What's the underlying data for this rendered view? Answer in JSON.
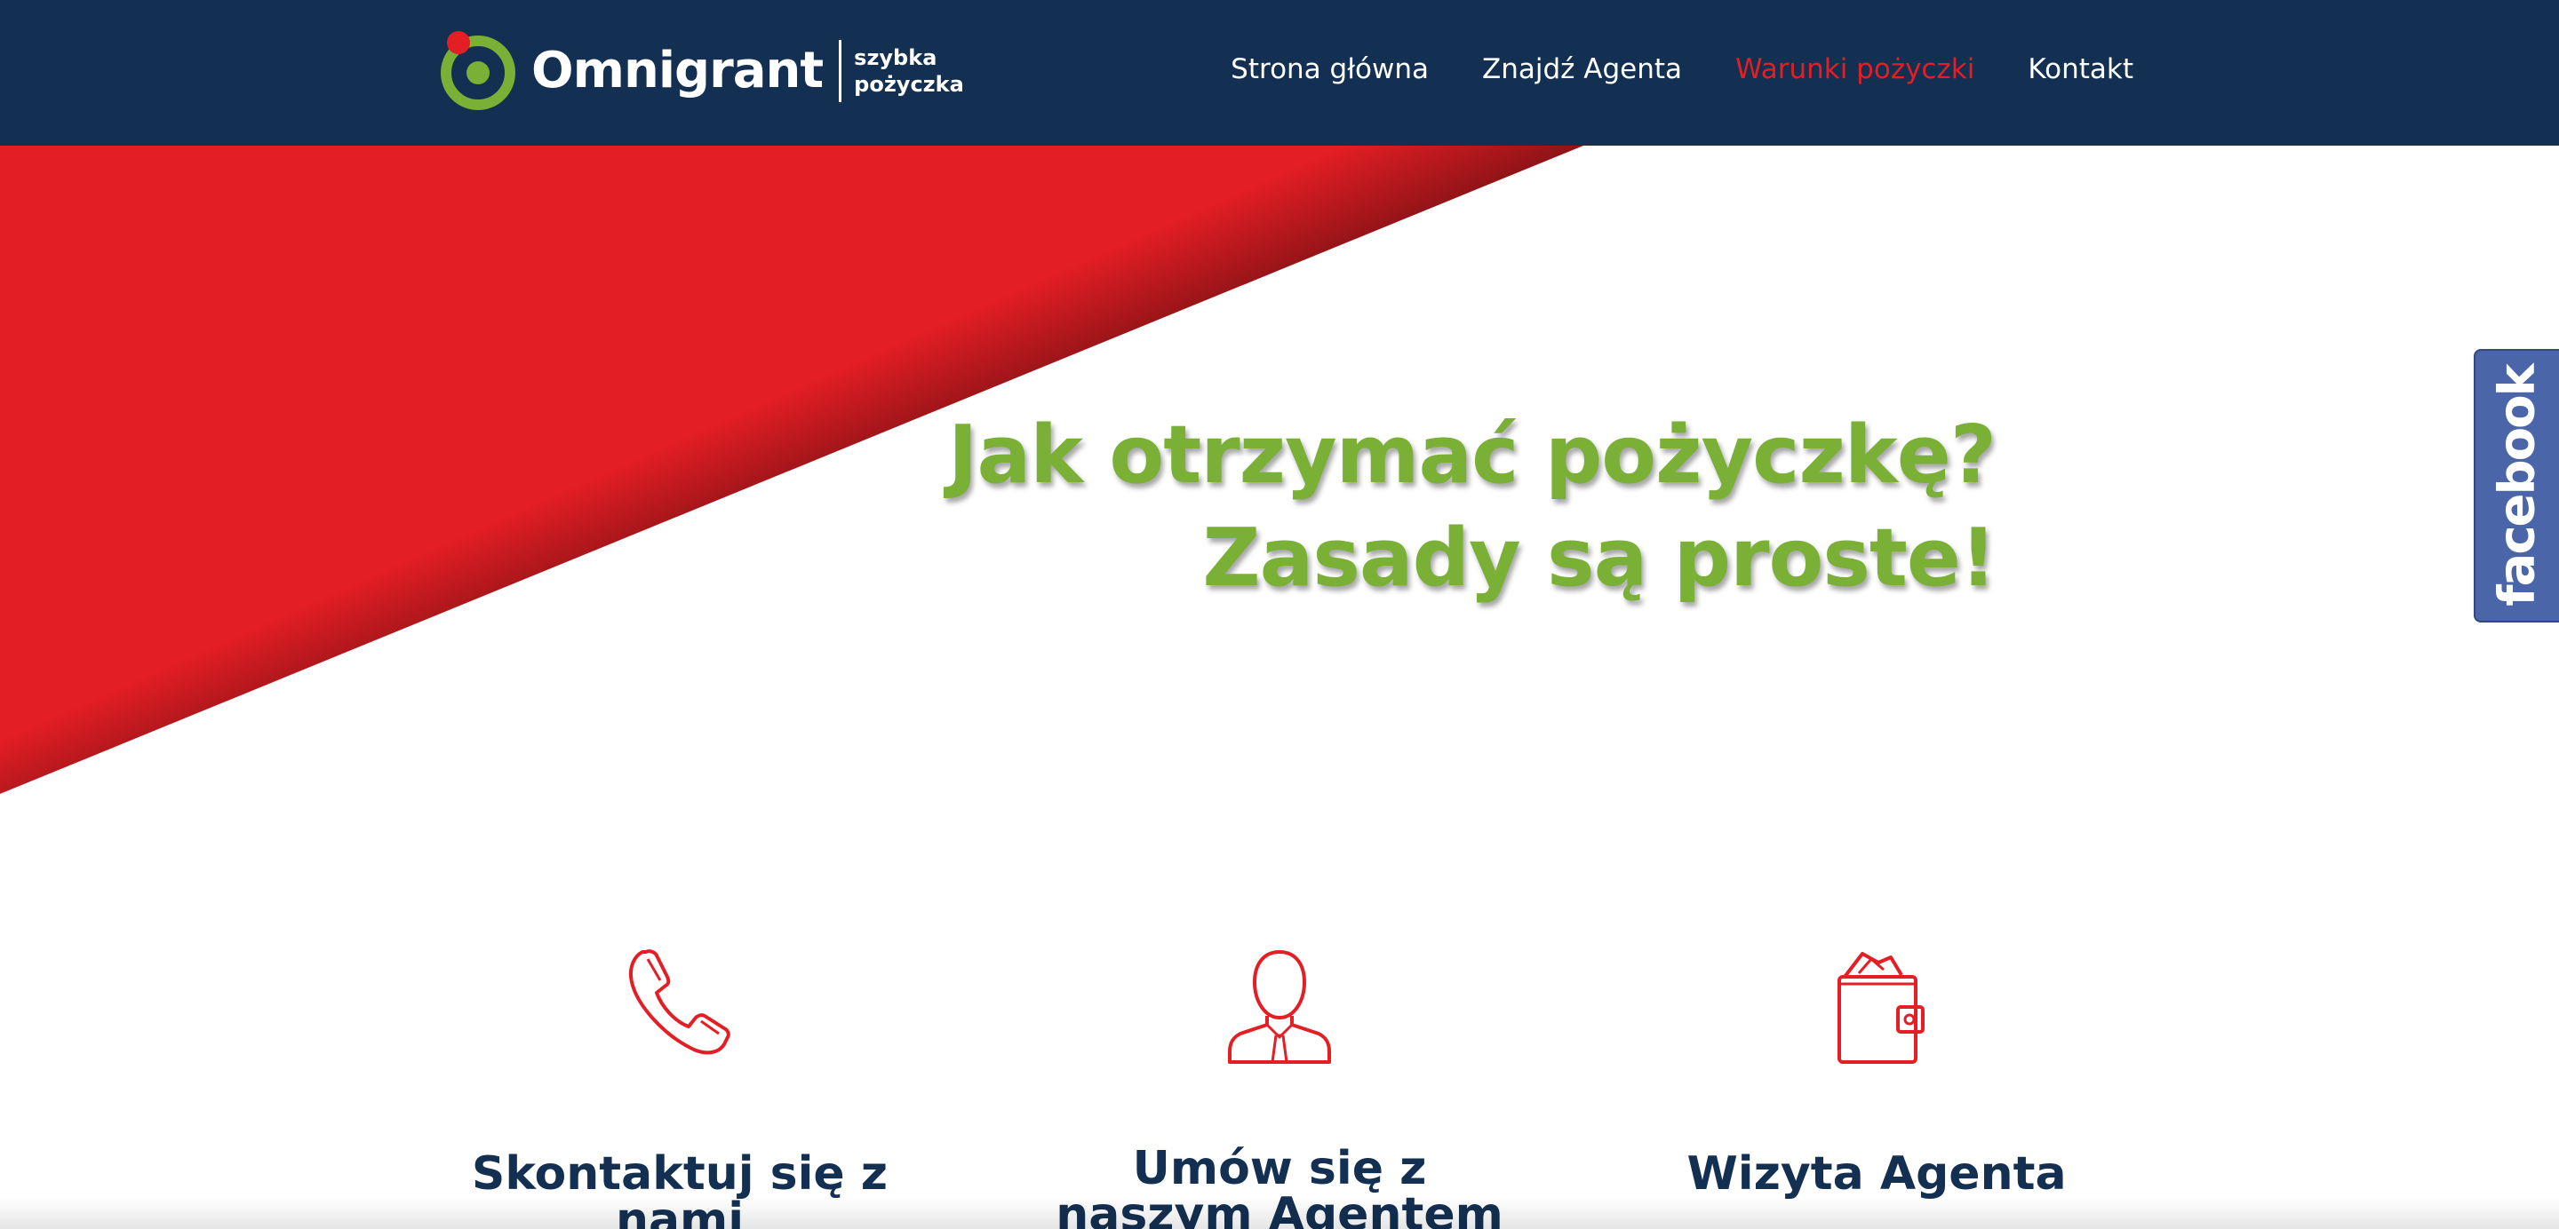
{
  "header": {
    "logo": {
      "name": "Omnigrant",
      "tagline_line1": "szybka",
      "tagline_line2": "pożyczka"
    },
    "nav": [
      {
        "label": "Strona główna",
        "active": false
      },
      {
        "label": "Znajdź Agenta",
        "active": false
      },
      {
        "label": "Warunki pożyczki",
        "active": true
      },
      {
        "label": "Kontakt",
        "active": false
      }
    ]
  },
  "hero": {
    "title_line1": "Jak otrzymać pożyczkę?",
    "title_line2": "Zasady są proste!"
  },
  "facebook_tab": {
    "label": "facebook"
  },
  "steps": [
    {
      "icon": "phone-icon",
      "title": "Skontaktuj się z nami"
    },
    {
      "icon": "agent-icon",
      "title": "Umów się z naszym Agentem"
    },
    {
      "icon": "wallet-icon",
      "title": "Wizyta Agenta"
    }
  ],
  "colors": {
    "navy": "#132f51",
    "red": "#e31e24",
    "green": "#7ab035",
    "facebook": "#4a66a8"
  }
}
